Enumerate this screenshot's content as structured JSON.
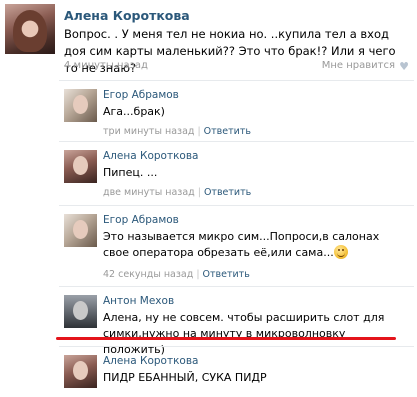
{
  "post": {
    "author": "Алена Короткова",
    "text": "Вопрос. . У меня тел не нокиа но. ..купила тел а вход доя сим карты маленький?? Это что брак!? Или я чего то не знаю?",
    "time": "4 минуты назад",
    "like_label": "Мне нравится",
    "like_icon": "heart-icon"
  },
  "comments": [
    {
      "author": "Егор Абрамов",
      "text": "Ага...брак)",
      "time": "три минуты назад",
      "reply_label": "Ответить",
      "avatar": "egor"
    },
    {
      "author": "Алена Короткова",
      "text": "Пипец. ...",
      "time": "две минуты назад",
      "reply_label": "Ответить",
      "avatar": "alena"
    },
    {
      "author": "Егор Абрамов",
      "text": "Это называется микро сим...Попроси,в салонах свое оператора обрезать её,или сама...",
      "time": "42 секунды назад",
      "reply_label": "Ответить",
      "avatar": "egor",
      "emoji": "smiley-icon"
    },
    {
      "author": "Антон Мехов",
      "text": "Алена, ну не совсем. чтобы расширить слот для симки,нужно на минуту в микроволновку положить)",
      "avatar": "anton"
    },
    {
      "author": "Алена Короткова",
      "text": "ПИДР ЕБАННЫЙ, СУКА ПИДР",
      "avatar": "alena"
    }
  ],
  "colors": {
    "link": "#2b587a",
    "meta": "#999999",
    "highlight_underline": "#e4141b"
  }
}
